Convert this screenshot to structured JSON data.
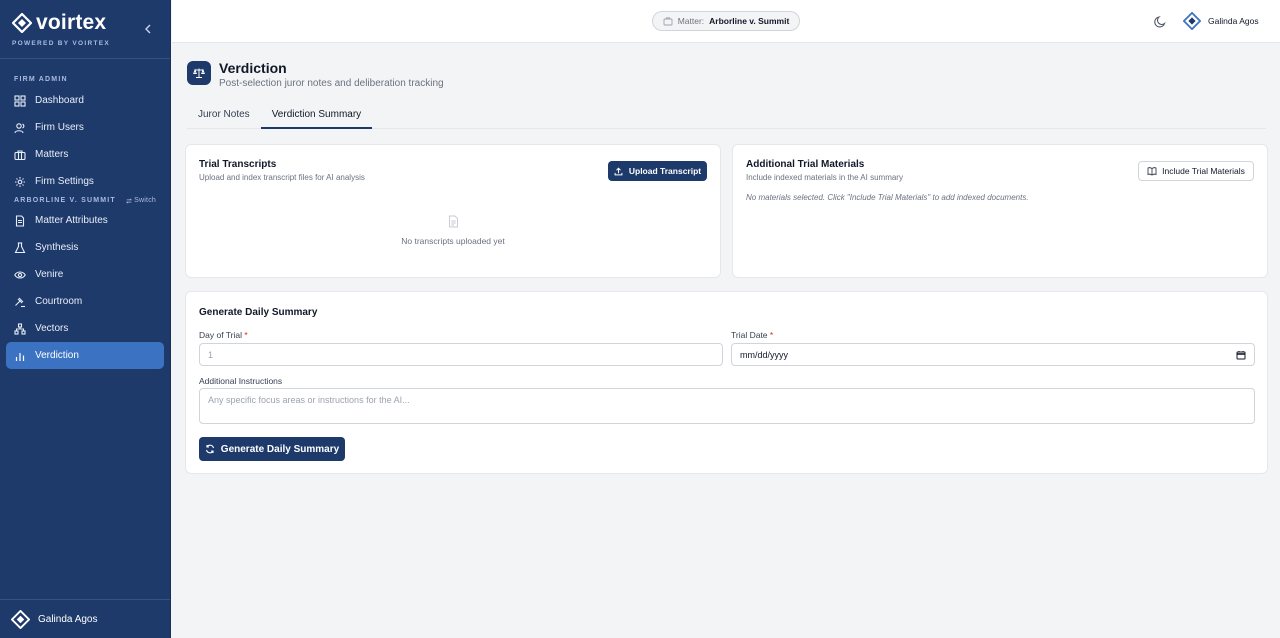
{
  "sidebar": {
    "brand": "voirtex",
    "brand_sub": "POWERED BY VOIRTEX",
    "section_firm": "FIRM ADMIN",
    "section_matter": "ARBORLINE V. SUMMIT",
    "switch_label": "Switch",
    "items": [
      {
        "label": "Dashboard",
        "icon": "grid-icon"
      },
      {
        "label": "Firm Users",
        "icon": "users-icon"
      },
      {
        "label": "Matters",
        "icon": "briefcase-icon"
      },
      {
        "label": "Firm Settings",
        "icon": "gear-icon"
      },
      {
        "label": "Matter Attributes",
        "icon": "document-icon"
      },
      {
        "label": "Synthesis",
        "icon": "flask-icon"
      },
      {
        "label": "Venire",
        "icon": "eye-icon"
      },
      {
        "label": "Courtroom",
        "icon": "gavel-icon"
      },
      {
        "label": "Vectors",
        "icon": "network-icon"
      },
      {
        "label": "Verdiction",
        "icon": "bar-chart-icon"
      }
    ],
    "active_item": "Verdiction",
    "footer_user": "Galinda Agos"
  },
  "topbar": {
    "matter_prefix": "Matter:",
    "matter_name": "Arborline v. Summit",
    "user_name": "Galinda Agos"
  },
  "header": {
    "title": "Verdiction",
    "subtitle": "Post-selection juror notes and deliberation tracking"
  },
  "tabs": [
    {
      "label": "Juror Notes",
      "active": false
    },
    {
      "label": "Verdiction Summary",
      "active": true
    }
  ],
  "transcripts": {
    "title": "Trial Transcripts",
    "description": "Upload and index transcript files for AI analysis",
    "upload_label": "Upload Transcript",
    "empty_text": "No transcripts uploaded yet"
  },
  "materials": {
    "title": "Additional Trial Materials",
    "description": "Include indexed materials in the AI summary",
    "button_label": "Include Trial Materials",
    "note": "No materials selected. Click \"Include Trial Materials\" to add indexed documents."
  },
  "generate": {
    "title": "Generate Daily Summary",
    "day_label": "Day of Trial",
    "day_placeholder": "1",
    "date_label": "Trial Date",
    "date_value": "mm/dd/yyyy",
    "required_mark": "*",
    "instructions_label": "Additional Instructions",
    "instructions_placeholder": "Any specific focus areas or instructions for the AI...",
    "button_label": "Generate Daily Summary"
  },
  "colors": {
    "sidebar_bg": "#1e3a6b",
    "active_item_bg": "#3b73c2",
    "primary_button": "#1e3a6b",
    "page_bg": "#f3f4f6",
    "required": "#dc2626"
  }
}
